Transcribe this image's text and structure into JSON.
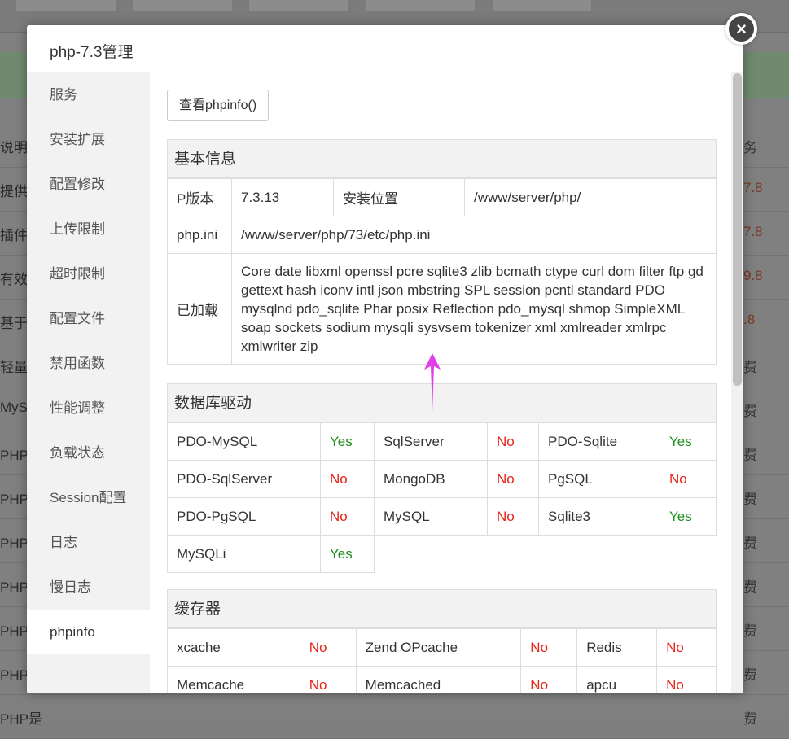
{
  "background": {
    "rows": [
      {
        "left": "说明",
        "right": "务"
      },
      {
        "left": "提供灵",
        "right": "7.8"
      },
      {
        "left": "插件型",
        "right": "7.8"
      },
      {
        "left": "有效防",
        "right": "9.8"
      },
      {
        "left": "基于rs",
        "right": ".8"
      },
      {
        "left": "轻量级",
        "right": "费"
      },
      {
        "left": "MySQ",
        "right": "费"
      },
      {
        "left": "PHP是",
        "right": "费"
      },
      {
        "left": "PHP是",
        "right": "费"
      },
      {
        "left": "PHP是",
        "right": "费"
      },
      {
        "left": "PHP是",
        "right": "费"
      },
      {
        "left": "PHP是",
        "right": "费"
      },
      {
        "left": "PHP是",
        "right": "费"
      },
      {
        "left": "PHP是",
        "right": "费"
      }
    ]
  },
  "modal": {
    "title": "php-7.3管理",
    "close_icon": "×"
  },
  "sidebar": {
    "items": [
      {
        "label": "服务"
      },
      {
        "label": "安装扩展"
      },
      {
        "label": "配置修改"
      },
      {
        "label": "上传限制"
      },
      {
        "label": "超时限制"
      },
      {
        "label": "配置文件"
      },
      {
        "label": "禁用函数"
      },
      {
        "label": "性能调整"
      },
      {
        "label": "负载状态"
      },
      {
        "label": "Session配置"
      },
      {
        "label": "日志"
      },
      {
        "label": "慢日志"
      },
      {
        "label": "phpinfo"
      }
    ],
    "active_index": 12
  },
  "content": {
    "phpinfo_button": "查看phpinfo()",
    "basic": {
      "title": "基本信息",
      "version_label": "P版本",
      "version_value": "7.3.13",
      "install_label": "安装位置",
      "install_value": "/www/server/php/",
      "ini_label": "php.ini",
      "ini_value": "/www/server/php/73/etc/php.ini",
      "loaded_label": "已加载",
      "loaded_value": "Core date libxml openssl pcre sqlite3 zlib bcmath ctype curl dom filter ftp gd gettext hash iconv intl json mbstring SPL session pcntl standard PDO mysqlnd pdo_sqlite Phar posix Reflection pdo_mysql shmop SimpleXML soap sockets sodium mysqli sysvsem tokenizer xml xmlreader xmlrpc xmlwriter zip"
    },
    "db": {
      "title": "数据库驱动",
      "rows": [
        [
          {
            "name": "PDO-MySQL",
            "status": "Yes"
          },
          {
            "name": "SqlServer",
            "status": "No"
          },
          {
            "name": "PDO-Sqlite",
            "status": "Yes"
          }
        ],
        [
          {
            "name": "PDO-SqlServer",
            "status": "No"
          },
          {
            "name": "MongoDB",
            "status": "No"
          },
          {
            "name": "PgSQL",
            "status": "No"
          }
        ],
        [
          {
            "name": "PDO-PgSQL",
            "status": "No"
          },
          {
            "name": "MySQL",
            "status": "No"
          },
          {
            "name": "Sqlite3",
            "status": "Yes"
          }
        ],
        [
          {
            "name": "MySQLi",
            "status": "Yes"
          }
        ]
      ]
    },
    "cache": {
      "title": "缓存器",
      "rows": [
        [
          {
            "name": "xcache",
            "status": "No"
          },
          {
            "name": "Zend OPcache",
            "status": "No"
          },
          {
            "name": "Redis",
            "status": "No"
          }
        ],
        [
          {
            "name": "Memcache",
            "status": "No"
          },
          {
            "name": "Memcached",
            "status": "No"
          },
          {
            "name": "apcu",
            "status": "No"
          }
        ]
      ]
    }
  },
  "colors": {
    "yes": "#1f8f1f",
    "no": "#e8231a",
    "arrow": "#e23de6"
  }
}
